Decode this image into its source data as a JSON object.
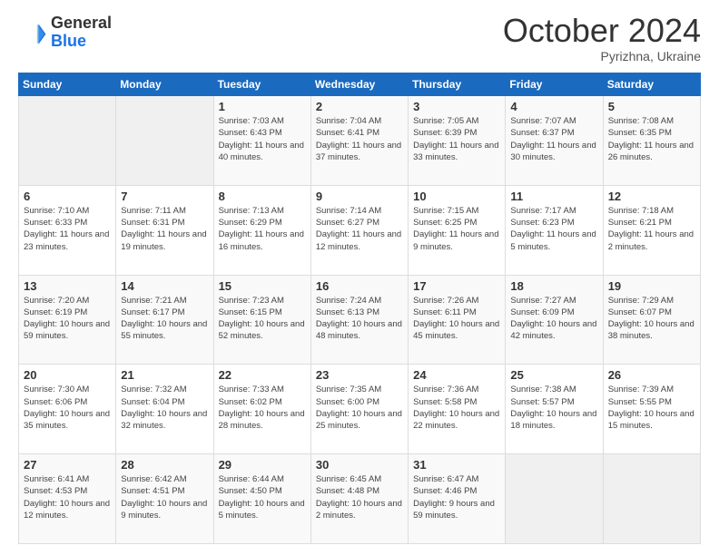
{
  "header": {
    "logo": {
      "general": "General",
      "blue": "Blue"
    },
    "title": "October 2024",
    "location": "Pyrizhna, Ukraine"
  },
  "weekdays": [
    "Sunday",
    "Monday",
    "Tuesday",
    "Wednesday",
    "Thursday",
    "Friday",
    "Saturday"
  ],
  "weeks": [
    [
      {
        "day": "",
        "info": ""
      },
      {
        "day": "",
        "info": ""
      },
      {
        "day": "1",
        "info": "Sunrise: 7:03 AM\nSunset: 6:43 PM\nDaylight: 11 hours and 40 minutes."
      },
      {
        "day": "2",
        "info": "Sunrise: 7:04 AM\nSunset: 6:41 PM\nDaylight: 11 hours and 37 minutes."
      },
      {
        "day": "3",
        "info": "Sunrise: 7:05 AM\nSunset: 6:39 PM\nDaylight: 11 hours and 33 minutes."
      },
      {
        "day": "4",
        "info": "Sunrise: 7:07 AM\nSunset: 6:37 PM\nDaylight: 11 hours and 30 minutes."
      },
      {
        "day": "5",
        "info": "Sunrise: 7:08 AM\nSunset: 6:35 PM\nDaylight: 11 hours and 26 minutes."
      }
    ],
    [
      {
        "day": "6",
        "info": "Sunrise: 7:10 AM\nSunset: 6:33 PM\nDaylight: 11 hours and 23 minutes."
      },
      {
        "day": "7",
        "info": "Sunrise: 7:11 AM\nSunset: 6:31 PM\nDaylight: 11 hours and 19 minutes."
      },
      {
        "day": "8",
        "info": "Sunrise: 7:13 AM\nSunset: 6:29 PM\nDaylight: 11 hours and 16 minutes."
      },
      {
        "day": "9",
        "info": "Sunrise: 7:14 AM\nSunset: 6:27 PM\nDaylight: 11 hours and 12 minutes."
      },
      {
        "day": "10",
        "info": "Sunrise: 7:15 AM\nSunset: 6:25 PM\nDaylight: 11 hours and 9 minutes."
      },
      {
        "day": "11",
        "info": "Sunrise: 7:17 AM\nSunset: 6:23 PM\nDaylight: 11 hours and 5 minutes."
      },
      {
        "day": "12",
        "info": "Sunrise: 7:18 AM\nSunset: 6:21 PM\nDaylight: 11 hours and 2 minutes."
      }
    ],
    [
      {
        "day": "13",
        "info": "Sunrise: 7:20 AM\nSunset: 6:19 PM\nDaylight: 10 hours and 59 minutes."
      },
      {
        "day": "14",
        "info": "Sunrise: 7:21 AM\nSunset: 6:17 PM\nDaylight: 10 hours and 55 minutes."
      },
      {
        "day": "15",
        "info": "Sunrise: 7:23 AM\nSunset: 6:15 PM\nDaylight: 10 hours and 52 minutes."
      },
      {
        "day": "16",
        "info": "Sunrise: 7:24 AM\nSunset: 6:13 PM\nDaylight: 10 hours and 48 minutes."
      },
      {
        "day": "17",
        "info": "Sunrise: 7:26 AM\nSunset: 6:11 PM\nDaylight: 10 hours and 45 minutes."
      },
      {
        "day": "18",
        "info": "Sunrise: 7:27 AM\nSunset: 6:09 PM\nDaylight: 10 hours and 42 minutes."
      },
      {
        "day": "19",
        "info": "Sunrise: 7:29 AM\nSunset: 6:07 PM\nDaylight: 10 hours and 38 minutes."
      }
    ],
    [
      {
        "day": "20",
        "info": "Sunrise: 7:30 AM\nSunset: 6:06 PM\nDaylight: 10 hours and 35 minutes."
      },
      {
        "day": "21",
        "info": "Sunrise: 7:32 AM\nSunset: 6:04 PM\nDaylight: 10 hours and 32 minutes."
      },
      {
        "day": "22",
        "info": "Sunrise: 7:33 AM\nSunset: 6:02 PM\nDaylight: 10 hours and 28 minutes."
      },
      {
        "day": "23",
        "info": "Sunrise: 7:35 AM\nSunset: 6:00 PM\nDaylight: 10 hours and 25 minutes."
      },
      {
        "day": "24",
        "info": "Sunrise: 7:36 AM\nSunset: 5:58 PM\nDaylight: 10 hours and 22 minutes."
      },
      {
        "day": "25",
        "info": "Sunrise: 7:38 AM\nSunset: 5:57 PM\nDaylight: 10 hours and 18 minutes."
      },
      {
        "day": "26",
        "info": "Sunrise: 7:39 AM\nSunset: 5:55 PM\nDaylight: 10 hours and 15 minutes."
      }
    ],
    [
      {
        "day": "27",
        "info": "Sunrise: 6:41 AM\nSunset: 4:53 PM\nDaylight: 10 hours and 12 minutes."
      },
      {
        "day": "28",
        "info": "Sunrise: 6:42 AM\nSunset: 4:51 PM\nDaylight: 10 hours and 9 minutes."
      },
      {
        "day": "29",
        "info": "Sunrise: 6:44 AM\nSunset: 4:50 PM\nDaylight: 10 hours and 5 minutes."
      },
      {
        "day": "30",
        "info": "Sunrise: 6:45 AM\nSunset: 4:48 PM\nDaylight: 10 hours and 2 minutes."
      },
      {
        "day": "31",
        "info": "Sunrise: 6:47 AM\nSunset: 4:46 PM\nDaylight: 9 hours and 59 minutes."
      },
      {
        "day": "",
        "info": ""
      },
      {
        "day": "",
        "info": ""
      }
    ]
  ]
}
